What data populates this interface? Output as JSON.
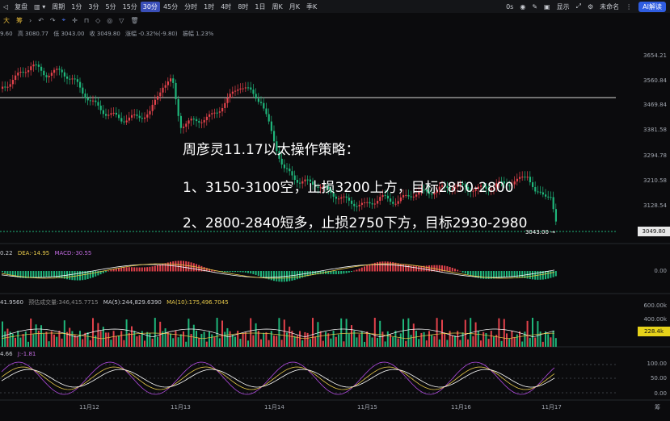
{
  "toolbar": {
    "left": [
      "复盘",
      "周期",
      "1分",
      "3分",
      "5分",
      "15分",
      "30分",
      "45分",
      "分时",
      "1时",
      "4时",
      "8时",
      "1日",
      "周K",
      "月K",
      "季K"
    ],
    "active": "30分",
    "right": [
      "0s",
      "显示",
      "未命名",
      "AI解读"
    ]
  },
  "drawbar": {
    "items": [
      "大",
      "筹"
    ]
  },
  "ohlc": {
    "items": [
      "9.60",
      "高 3080.77",
      "低 3043.00",
      "收 3049.80",
      "涨幅 -0.32%(-9.80)",
      "振幅 1.23%"
    ]
  },
  "price_axis": [
    "3654.21",
    "3560.84",
    "3469.84",
    "3381.58",
    "3294.78",
    "3210.58",
    "3128.54"
  ],
  "last_price_label": "3043.00 →",
  "current_price": "3049.80",
  "annotation": {
    "title": "周彦灵11.17以太操作策略：",
    "line1": "1、3150-3100空，止损3200上方，目标2850-2800",
    "line2": "2、2800-2840短多，止损2750下方，目标2930-2980"
  },
  "macd": {
    "items": [
      "0.22",
      "DEA:-14.95",
      "MACD:-30.55"
    ],
    "axis": "0.00"
  },
  "volume": {
    "items": [
      "41.9560",
      "预估成交量:346,415.7715",
      "MA(5):244,829.6390",
      "MA(10):175,496.7045"
    ],
    "axis": [
      "600.00k",
      "400.00k"
    ],
    "current": "228.4k"
  },
  "kdj": {
    "items": [
      "4.66",
      "J:-1.81"
    ],
    "axis": [
      "100.00",
      "50.00",
      "0.00"
    ]
  },
  "dates": [
    "11月12",
    "11月13",
    "11月14",
    "11月15",
    "11月16",
    "11月17"
  ],
  "corner": "筹",
  "colors": {
    "up": "#e2424b",
    "down": "#1fb57a",
    "k": "#e6c84a",
    "d": "#ffffff",
    "j": "#b04adf",
    "accent": "#3a4fb8"
  }
}
